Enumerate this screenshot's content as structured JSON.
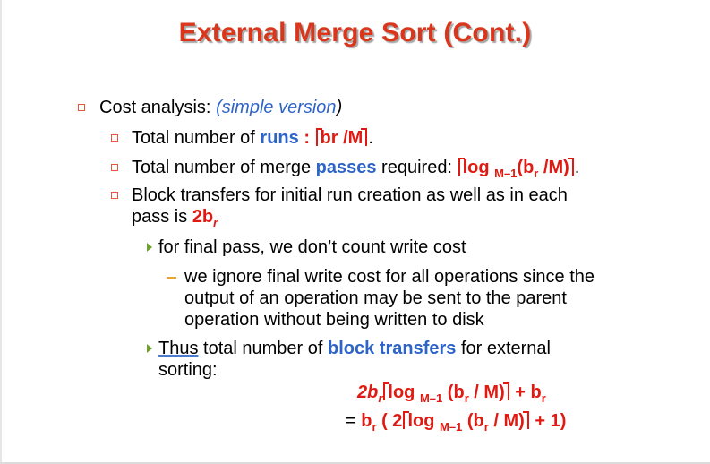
{
  "slide": {
    "title": "External Merge Sort (Cont.)",
    "level1": {
      "label": "Cost analysis: ",
      "paren": "(simple version)",
      "paren_open": "(",
      "paren_close": ")"
    },
    "item_runs": {
      "prefix": "Total number of ",
      "keyword": "runs",
      "colon": " : ",
      "formula": "br /M",
      "suffix": "."
    },
    "item_passes": {
      "prefix": "Total number of merge ",
      "keyword": "passes",
      "mid": " required: ",
      "log": "log ",
      "log_base": "M–1",
      "arg": "(b",
      "arg_sub": "r",
      "arg_rest": " /M)",
      "suffix": "."
    },
    "item_blocks": {
      "line1": "Block transfers for initial run creation as well as in each",
      "line2_prefix": "pass is ",
      "value": "2b",
      "value_sub": "r"
    },
    "sub_final_pass": "for final pass, we don’t count write cost",
    "sub_sub_ignore": {
      "line1": "we ignore final write cost for all operations since the",
      "line2": "output of an operation may be sent to the parent",
      "line3": "operation without being written to disk"
    },
    "sub_thus": {
      "word": "Thus",
      "mid": " total number of ",
      "keyword": "block transfers",
      "suffix": " for external",
      "line2": "sorting:"
    },
    "formula_1": {
      "lead": "2b",
      "lead_sub": "r",
      "log": "log ",
      "base": "M–1",
      "arg": " (b",
      "arg_sub": "r",
      "arg_rest": " / M)",
      "plus": " + b",
      "plus_sub": "r"
    },
    "formula_2": {
      "eq": "= ",
      "b": "b",
      "b_sub": "r",
      "open": " ( 2",
      "log": "log ",
      "base": "M–1",
      "arg": " (b",
      "arg_sub": "r",
      "arg_rest": " / M)",
      "tail": " + 1)"
    }
  },
  "colors": {
    "title": "#d9361c",
    "accent_blue": "#2e63c8",
    "accent_red": "#e01a12",
    "bullet_square": "#e6553a",
    "bullet_arrow": "#6fa02f",
    "bullet_dash": "#e8a43a"
  }
}
